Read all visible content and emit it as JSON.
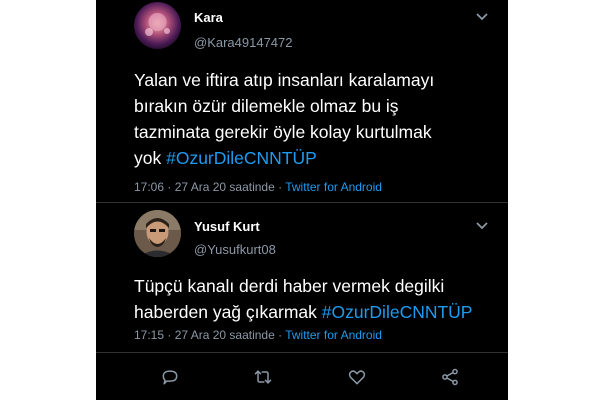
{
  "tweets": [
    {
      "name": "Kara",
      "handle": "@Kara49147472",
      "text_lines": [
        "Yalan ve iftira atıp insanları karalamayı",
        "bırakın özür dilemekle olmaz bu iş",
        "tazminata gerekir öyle kolay kurtulmak",
        "yok"
      ],
      "hashtag": "#OzurDileCNNTÜP",
      "time": "17:06 · 27 Ara 20 saatinde · ",
      "app": "Twitter for Android",
      "avatar_icon": "avatar-decorative-purple",
      "menu_icon": "chevron-down-icon"
    },
    {
      "name": "Yusuf Kurt",
      "handle": "@Yusufkurt08",
      "text_lines": [
        "Tüpçü kanalı derdi haber vermek degilki",
        "haberden yağ çıkarmak"
      ],
      "hashtag": "#OzurDileCNNTÜP",
      "time": "17:15 · 27 Ara 20 saatinde · ",
      "app": "Twitter for Android",
      "avatar_icon": "avatar-photo-man",
      "menu_icon": "chevron-down-icon"
    }
  ],
  "actions": [
    "reply-icon",
    "retweet-icon",
    "like-icon",
    "share-icon"
  ],
  "colors": {
    "background": "#000000",
    "text": "#ffffff",
    "secondary": "#8b98a5",
    "link": "#1d9bf0",
    "divider": "#2f3336"
  }
}
